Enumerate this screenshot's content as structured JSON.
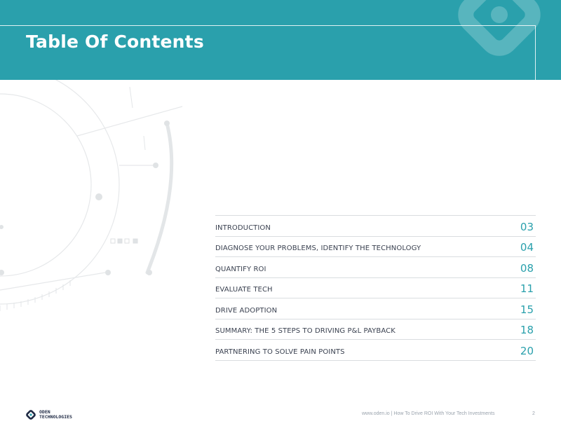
{
  "header": {
    "title": "Table Of Contents"
  },
  "toc": {
    "items": [
      {
        "label": "INTRODUCTION",
        "page": "03"
      },
      {
        "label": "DIAGNOSE YOUR PROBLEMS, IDENTIFY THE TECHNOLOGY",
        "page": "04"
      },
      {
        "label": "QUANTIFY ROI",
        "page": "08"
      },
      {
        "label": "EVALUATE TECH",
        "page": "11"
      },
      {
        "label": "DRIVE ADOPTION",
        "page": "15"
      },
      {
        "label": "SUMMARY: THE 5 STEPS TO DRIVING P&L PAYBACK",
        "page": "18"
      },
      {
        "label": "PARTNERING TO SOLVE PAIN POINTS",
        "page": "20"
      }
    ]
  },
  "footer": {
    "logo_line1": "ODEN",
    "logo_line2": "TECHNOLOGIES",
    "text": "www.oden.io | How To Drive ROI With Your Tech Investments",
    "page_number": "2"
  },
  "colors": {
    "accent": "#2aa0ac",
    "text_dark": "#3a4150",
    "rule": "#d9dde0",
    "footer_text": "#9aa3ad"
  }
}
